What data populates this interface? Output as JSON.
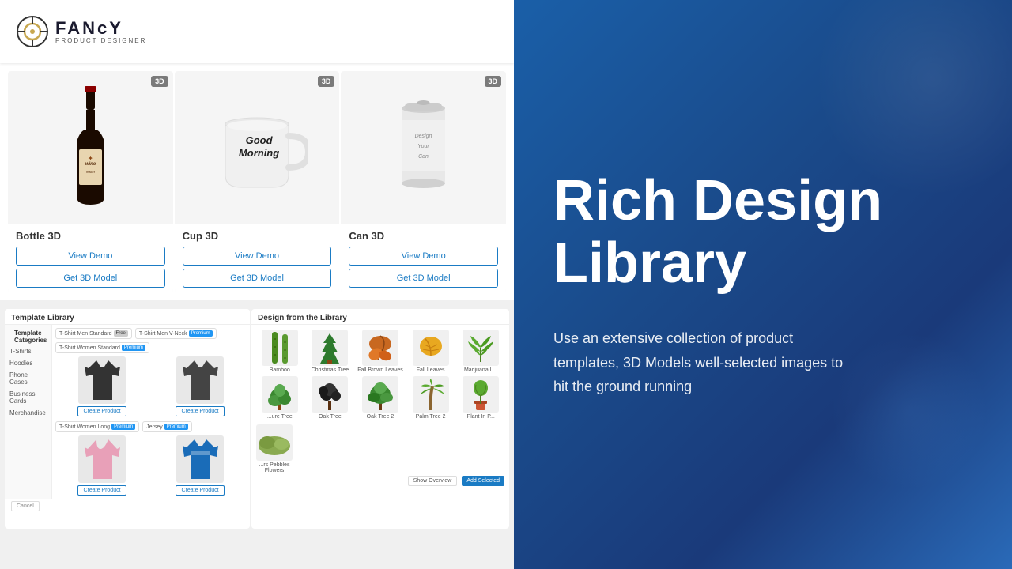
{
  "brand": {
    "name": "FANcY",
    "sub": "PRODUCT DESIGNER"
  },
  "products": [
    {
      "id": "bottle",
      "badge": "3D",
      "title": "Bottle 3D",
      "view_demo": "View Demo",
      "get_model": "Get 3D Model"
    },
    {
      "id": "cup",
      "badge": "3D",
      "title": "Cup 3D",
      "mug_text_line1": "Good",
      "mug_text_line2": "Morning",
      "view_demo": "View Demo",
      "get_model": "Get 3D Model"
    },
    {
      "id": "can",
      "badge": "3D",
      "title": "Can 3D",
      "can_text": "Design Your Can",
      "view_demo": "View Demo",
      "get_model": "Get 3D Model"
    }
  ],
  "template_library": {
    "title": "Template Library",
    "sub_title": "Template Categories",
    "categories": [
      "T-Shirts",
      "Hoodies",
      "Phone Cases",
      "Business Cards",
      "Merchandise"
    ],
    "tabs": [
      {
        "label": "T-Shirt Men Standard",
        "badge": "Free"
      },
      {
        "label": "T-Shirt Men V-Neck",
        "badge": "Premium"
      },
      {
        "label": "T-Shirt Women Standard",
        "badge": "Premium"
      }
    ],
    "footer_buttons": [
      "Cancel"
    ]
  },
  "design_library": {
    "title": "Design from the Library",
    "items": [
      {
        "label": "Bamboo"
      },
      {
        "label": "Christmas Tree"
      },
      {
        "label": "Fall Brown Leaves"
      },
      {
        "label": "Fall Leaves"
      },
      {
        "label": "Marijuana L..."
      },
      {
        "label": "...ure Tree"
      },
      {
        "label": "Oak Tree"
      },
      {
        "label": "Oak Tree 2"
      },
      {
        "label": "Palm Tree 2"
      },
      {
        "label": "Plant In P..."
      }
    ],
    "show_overview": "Show Overview",
    "add_selected": "Add Selected"
  },
  "right_panel": {
    "title_line1": "Rich Design",
    "title_line2": "Library",
    "description": "Use an extensive collection of product templates, 3D Models well-selected images to hit the ground running"
  }
}
